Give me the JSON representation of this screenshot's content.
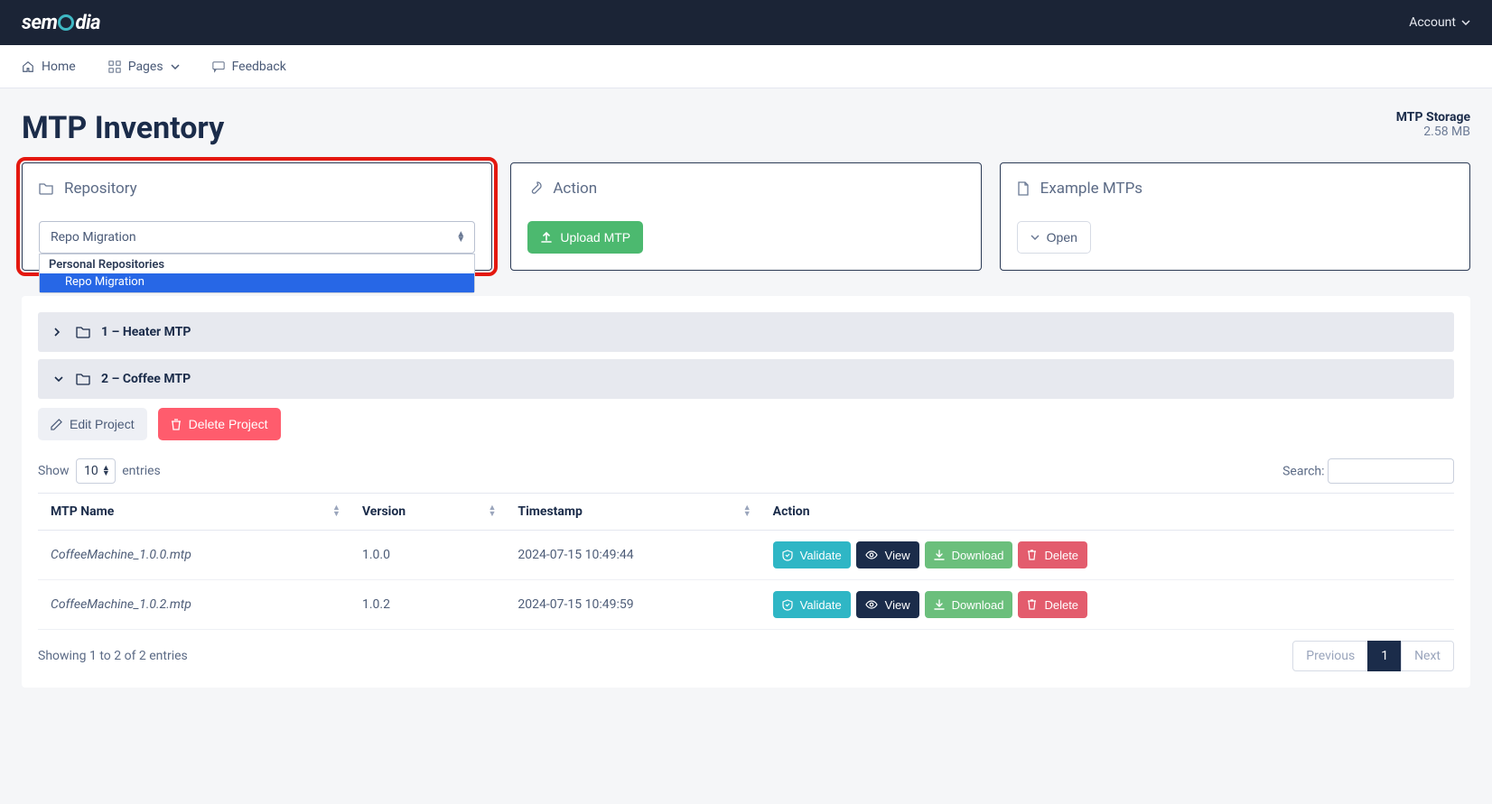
{
  "navbar": {
    "logo_pre": "sem",
    "logo_post": "dia",
    "account": "Account"
  },
  "subnav": {
    "home": "Home",
    "pages": "Pages",
    "feedback": "Feedback"
  },
  "header": {
    "title": "MTP Inventory",
    "storage_label": "MTP Storage",
    "storage_value": "2.58 MB"
  },
  "cards": {
    "repository": {
      "title": "Repository",
      "selected": "Repo Migration",
      "group": "Personal Repositories",
      "option1": "Repo Migration"
    },
    "action": {
      "title": "Action",
      "upload_btn": "Upload MTP"
    },
    "example": {
      "title": "Example MTPs",
      "open_btn": "Open"
    }
  },
  "projects": {
    "row1": "1 – Heater MTP",
    "row2": "2 – Coffee MTP",
    "edit_btn": "Edit Project",
    "delete_btn": "Delete Project"
  },
  "table": {
    "show": "Show",
    "entries": "entries",
    "entries_val": "10",
    "search_label": "Search:",
    "col_name": "MTP Name",
    "col_version": "Version",
    "col_timestamp": "Timestamp",
    "col_action": "Action",
    "rows": [
      {
        "name": "CoffeeMachine_1.0.0.mtp",
        "version": "1.0.0",
        "ts": "2024-07-15 10:49:44"
      },
      {
        "name": "CoffeeMachine_1.0.2.mtp",
        "version": "1.0.2",
        "ts": "2024-07-15 10:49:59"
      }
    ],
    "validate": "Validate",
    "view": "View",
    "download": "Download",
    "delete": "Delete",
    "showing": "Showing 1 to 2 of 2 entries",
    "prev": "Previous",
    "page": "1",
    "next": "Next"
  }
}
